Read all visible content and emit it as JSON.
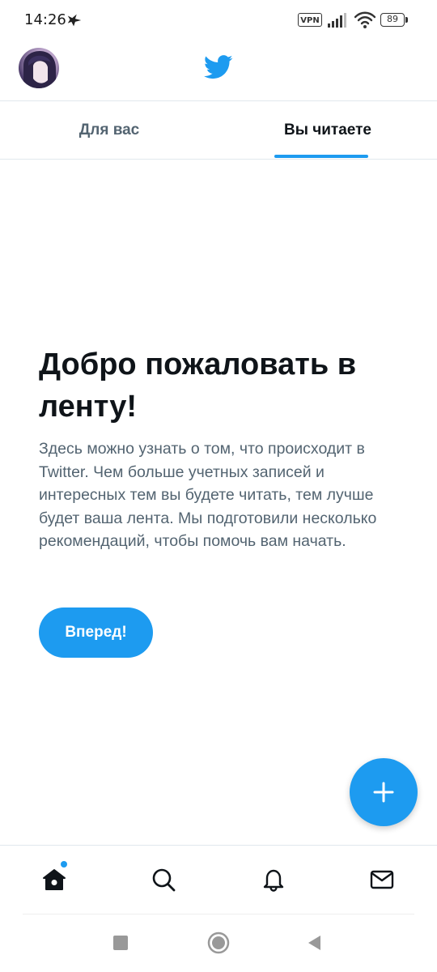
{
  "status_bar": {
    "time": "14:26",
    "vpn_label": "VPN",
    "battery_level": "89"
  },
  "header": {
    "logo_icon": "bird-logo-icon",
    "brand_color": "#1d9bf0"
  },
  "tabs": [
    {
      "label": "Для вас",
      "active": false
    },
    {
      "label": "Вы читаете",
      "active": true
    }
  ],
  "welcome": {
    "title": "Добро пожаловать в ленту!",
    "text": "Здесь можно узнать о том, что происходит в Twitter. Чем больше учетных записей и интересных тем вы будете читать, тем лучше будет ваша лента. Мы подготовили несколько рекомендаций, чтобы помочь вам начать.",
    "button_label": "Вперед!"
  },
  "fab": {
    "icon": "plus-icon"
  },
  "bottom_nav": [
    {
      "icon": "home-icon",
      "has_badge": true
    },
    {
      "icon": "search-icon"
    },
    {
      "icon": "bell-icon"
    },
    {
      "icon": "envelope-icon"
    }
  ],
  "system_nav": [
    "recents-icon",
    "home-circle-icon",
    "back-icon"
  ]
}
